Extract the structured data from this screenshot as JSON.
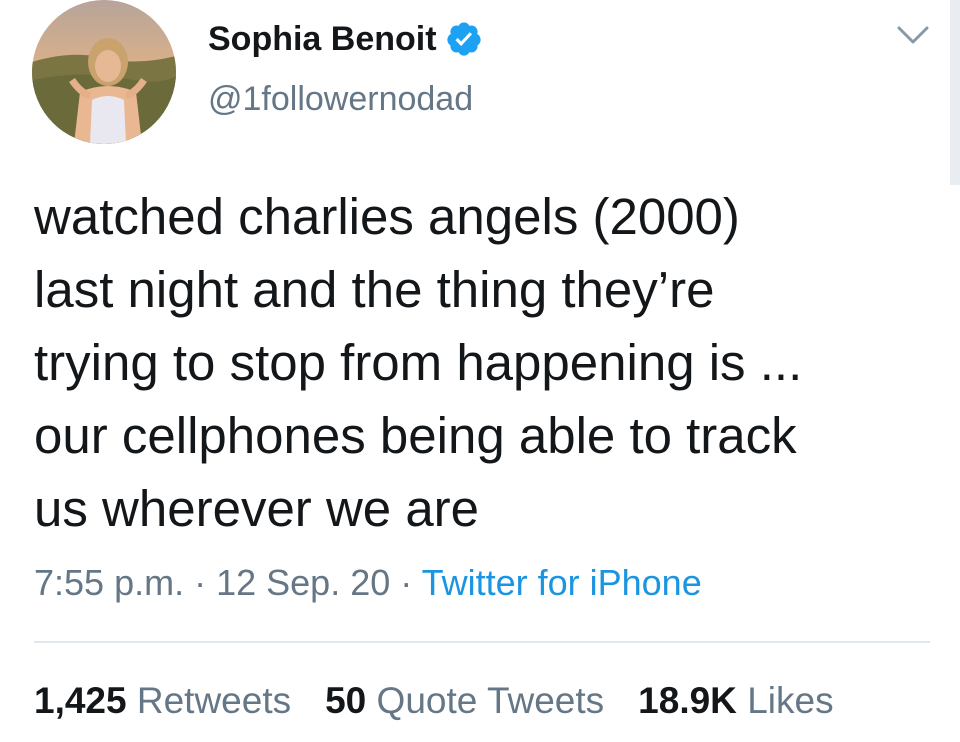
{
  "author": {
    "display_name": "Sophia Benoit",
    "handle": "@1followernodad",
    "verified_icon": "verified-badge-icon"
  },
  "tweet": {
    "text": "watched charlies angels (2000)\nlast night and the thing they’re\ntrying to stop from happening is ...\nour cellphones being able to track\nus wherever we are"
  },
  "meta": {
    "time": "7:55 p.m.",
    "separator": " · ",
    "date": "12 Sep. 20",
    "source": "Twitter for iPhone"
  },
  "stats": {
    "retweets_count": "1,425",
    "retweets_label": "Retweets",
    "quotes_count": "50",
    "quotes_label": "Quote Tweets",
    "likes_count": "18.9K",
    "likes_label": "Likes"
  },
  "colors": {
    "verified": "#1da1f2",
    "secondary_text": "#657786",
    "link": "#1b95e0"
  }
}
